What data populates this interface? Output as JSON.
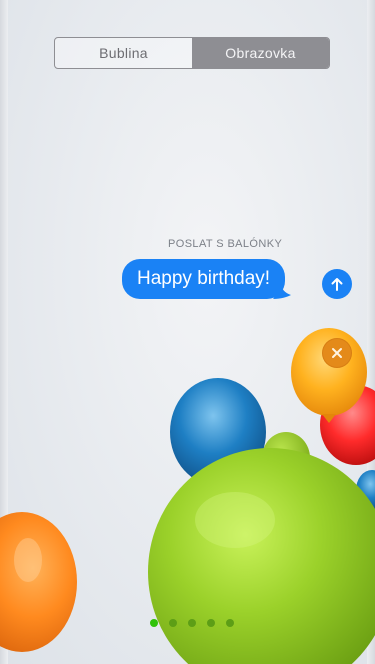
{
  "segmented_control": {
    "options": [
      {
        "label": "Bublina",
        "selected": false
      },
      {
        "label": "Obrazovka",
        "selected": true
      }
    ]
  },
  "effect": {
    "label": "POSLAT S BALÓNKY"
  },
  "message": {
    "text": "Happy birthday!"
  },
  "icons": {
    "send": "arrow-up-icon",
    "cancel": "close-icon"
  },
  "page_indicator": {
    "count": 5,
    "active_index": 0
  },
  "colors": {
    "imessage_blue": "#1a82f5",
    "segment_selected": "#8e8e93",
    "balloon_green": "#9bd12a",
    "balloon_orange": "#ff8a1f",
    "balloon_blue": "#1e7fc4",
    "balloon_red": "#ff2b2b",
    "balloon_yellow_orange": "#ffb21f",
    "active_dot": "#30c20a"
  }
}
